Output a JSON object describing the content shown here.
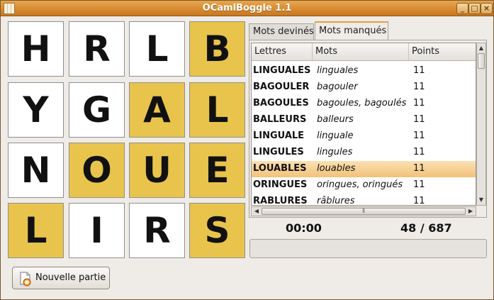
{
  "window": {
    "title": "OCamlBoggle 1.1",
    "min": "_",
    "max": "□",
    "close": "×"
  },
  "board": [
    {
      "letter": "H",
      "highlighted": false
    },
    {
      "letter": "R",
      "highlighted": false
    },
    {
      "letter": "L",
      "highlighted": false
    },
    {
      "letter": "B",
      "highlighted": true
    },
    {
      "letter": "Y",
      "highlighted": false
    },
    {
      "letter": "G",
      "highlighted": false
    },
    {
      "letter": "A",
      "highlighted": true
    },
    {
      "letter": "L",
      "highlighted": true
    },
    {
      "letter": "N",
      "highlighted": false
    },
    {
      "letter": "O",
      "highlighted": true
    },
    {
      "letter": "U",
      "highlighted": true
    },
    {
      "letter": "E",
      "highlighted": true
    },
    {
      "letter": "L",
      "highlighted": true
    },
    {
      "letter": "I",
      "highlighted": false
    },
    {
      "letter": "R",
      "highlighted": false
    },
    {
      "letter": "S",
      "highlighted": true
    }
  ],
  "colors": {
    "highlight": "#e8c44c",
    "tab_accent": "#e5a043",
    "title_bar": "#d9882e"
  },
  "tabs": [
    {
      "label": "Mots devinés",
      "active": false
    },
    {
      "label": "Mots manqués",
      "active": true
    }
  ],
  "table": {
    "headers": [
      "Lettres",
      "Mots",
      "Points"
    ],
    "rows": [
      {
        "letters": "LINGUALES",
        "words": "linguales",
        "points": "11",
        "selected": false
      },
      {
        "letters": "BAGOULER",
        "words": "bagouler",
        "points": "11",
        "selected": false
      },
      {
        "letters": "BAGOULES",
        "words": "bagoules, bagoulés",
        "points": "11",
        "selected": false
      },
      {
        "letters": "BALLEURS",
        "words": "balleurs",
        "points": "11",
        "selected": false
      },
      {
        "letters": "LINGUALE",
        "words": "linguale",
        "points": "11",
        "selected": false
      },
      {
        "letters": "LINGULES",
        "words": "lingules",
        "points": "11",
        "selected": false
      },
      {
        "letters": "LOUABLES",
        "words": "louables",
        "points": "11",
        "selected": true
      },
      {
        "letters": "ORINGUES",
        "words": "oringues, oringués",
        "points": "11",
        "selected": false
      },
      {
        "letters": "RABLURES",
        "words": "râblures",
        "points": "11",
        "selected": false
      }
    ]
  },
  "status": {
    "timer": "00:00",
    "score": "48 / 687"
  },
  "new_game_label": "Nouvelle partie"
}
